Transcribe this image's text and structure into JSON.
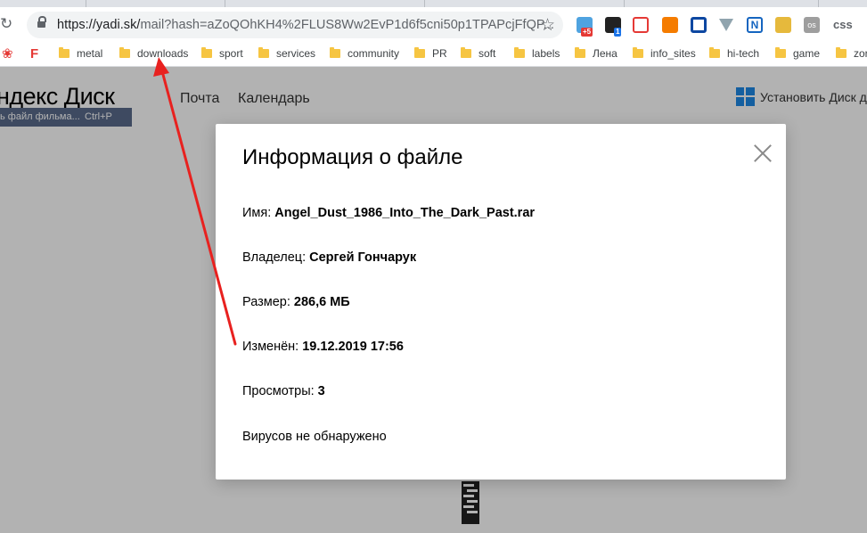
{
  "browser": {
    "url_host": "https://yadi.sk/",
    "url_rest": "mail?hash=aZoQOhKH4%2FLUS8Ww2EvP1d6f5cni50p1TPAPcjFfQP...",
    "extensions": [
      {
        "name": "cloud-extension-icon",
        "badge": "+5",
        "color": "#4fa3e0",
        "badge_color": "#e53935"
      },
      {
        "name": "cube-extension-icon",
        "badge": "1",
        "color": "#222222",
        "badge_color": "#1a73e8"
      },
      {
        "name": "lock-extension-icon",
        "color": "#e53935"
      },
      {
        "name": "face-extension-icon",
        "color": "#f57c00"
      },
      {
        "name": "screen-extension-icon",
        "color": "#0d47a1"
      },
      {
        "name": "download-extension-icon",
        "color": "#90a4ae"
      },
      {
        "name": "n-extension-icon",
        "label": "N",
        "color": "#1565c0"
      },
      {
        "name": "briefcase-extension-icon",
        "color": "#e6b93c"
      },
      {
        "name": "os-extension-icon",
        "label": "os",
        "color": "#9e9e9e"
      }
    ],
    "ext_css": "css",
    "bookmarks": [
      "metal",
      "downloads",
      "sport",
      "services",
      "community",
      "PR",
      "soft",
      "labels",
      "Лена",
      "info_sites",
      "hi-tech",
      "game",
      "zor"
    ]
  },
  "page": {
    "brand": "ндекс Диск",
    "hint": "ь файл фильма...",
    "hint_key": "Ctrl+P",
    "nav": [
      "Почта",
      "Календарь"
    ],
    "install": "Установить Диск дл"
  },
  "modal": {
    "title": "Информация о файле",
    "rows": [
      {
        "label": "Имя:",
        "value": "Angel_Dust_1986_Into_The_Dark_Past.rar"
      },
      {
        "label": "Владелец:",
        "value": "Сергей Гончарук"
      },
      {
        "label": "Размер:",
        "value": "286,6 МБ"
      },
      {
        "label": "Изменён:",
        "value": "19.12.2019 17:56"
      },
      {
        "label": "Просмотры:",
        "value": "3"
      }
    ],
    "virus_status": "Вирусов не обнаружено"
  },
  "colors": {
    "annotation": "#e8211f",
    "overlay": "rgba(0,0,0,0.3)"
  }
}
